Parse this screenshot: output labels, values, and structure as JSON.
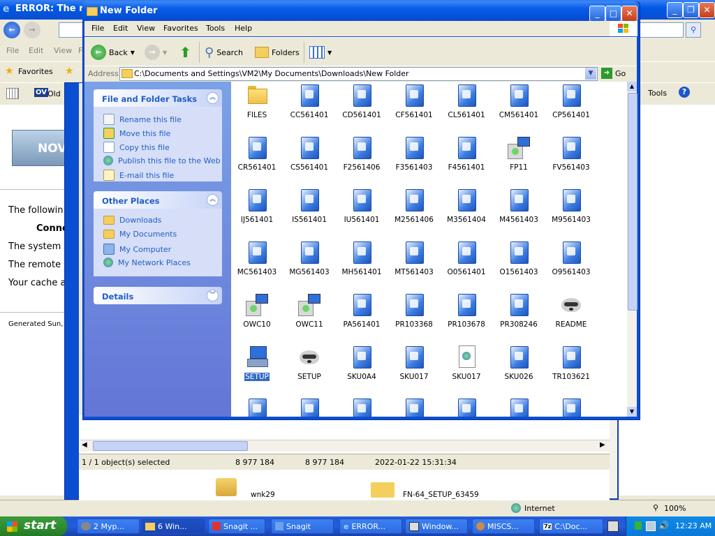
{
  "ie": {
    "title": "ERROR: The req",
    "menu": [
      "File",
      "Edit",
      "View",
      "F"
    ],
    "favorites_label": "Favorites",
    "ov_label": "Old",
    "tools_label": "Tools",
    "content_lines": [
      "The followin",
      "Conne",
      "The system",
      "The remote",
      "Your cache a"
    ],
    "generated": "Generated Sun,",
    "logo_text": "NOV",
    "status_zone": "Internet",
    "zoom": "100%"
  },
  "mid": {
    "status_items": [
      "1 / 1 object(s) selected",
      "8 977 184",
      "8 977 184",
      "2022-01-22 15:31:34"
    ],
    "bottom_items": [
      "wnk29",
      "FN-64_SETUP_63459"
    ]
  },
  "window": {
    "title": "New Folder",
    "menu": [
      "File",
      "Edit",
      "View",
      "Favorites",
      "Tools",
      "Help"
    ],
    "toolbar": {
      "back": "Back",
      "search": "Search",
      "folders": "Folders"
    },
    "address_label": "Address",
    "address": "C:\\Documents and Settings\\VM2\\My Documents\\Downloads\\New Folder",
    "go": "Go"
  },
  "tasks": {
    "title": "File and Folder Tasks",
    "items": [
      "Rename this file",
      "Move this file",
      "Copy this file",
      "Publish this file to the Web",
      "E-mail this file"
    ]
  },
  "places": {
    "title": "Other Places",
    "items": [
      "Downloads",
      "My Documents",
      "My Computer",
      "My Network Places"
    ]
  },
  "details": {
    "title": "Details"
  },
  "files": [
    {
      "name": "FILES",
      "icon": "folder"
    },
    {
      "name": "CC561401",
      "icon": "package"
    },
    {
      "name": "CD561401",
      "icon": "package"
    },
    {
      "name": "CF561401",
      "icon": "package"
    },
    {
      "name": "CL561401",
      "icon": "package"
    },
    {
      "name": "CM561401",
      "icon": "package"
    },
    {
      "name": "CP561401",
      "icon": "package"
    },
    {
      "name": "CR561401",
      "icon": "package"
    },
    {
      "name": "CS561401",
      "icon": "package"
    },
    {
      "name": "F2561406",
      "icon": "package"
    },
    {
      "name": "F3561403",
      "icon": "package"
    },
    {
      "name": "F4561401",
      "icon": "package"
    },
    {
      "name": "FP11",
      "icon": "installer"
    },
    {
      "name": "FV561403",
      "icon": "package"
    },
    {
      "name": "IJ561401",
      "icon": "package"
    },
    {
      "name": "IS561401",
      "icon": "package"
    },
    {
      "name": "IU561401",
      "icon": "package"
    },
    {
      "name": "M2561406",
      "icon": "package"
    },
    {
      "name": "M3561404",
      "icon": "package"
    },
    {
      "name": "M4561403",
      "icon": "package"
    },
    {
      "name": "M9561403",
      "icon": "package"
    },
    {
      "name": "MC561403",
      "icon": "package"
    },
    {
      "name": "MG561403",
      "icon": "package"
    },
    {
      "name": "MH561401",
      "icon": "package"
    },
    {
      "name": "MT561403",
      "icon": "package"
    },
    {
      "name": "O0561401",
      "icon": "package"
    },
    {
      "name": "O1561403",
      "icon": "package"
    },
    {
      "name": "O9561403",
      "icon": "package"
    },
    {
      "name": "OWC10",
      "icon": "installer"
    },
    {
      "name": "OWC11",
      "icon": "installer"
    },
    {
      "name": "PA561401",
      "icon": "package"
    },
    {
      "name": "PR103368",
      "icon": "package"
    },
    {
      "name": "PR103678",
      "icon": "package"
    },
    {
      "name": "PR308246",
      "icon": "package"
    },
    {
      "name": "README",
      "icon": "raccoon"
    },
    {
      "name": "SETUP",
      "icon": "setup",
      "selected": true
    },
    {
      "name": "SETUP",
      "icon": "raccoon"
    },
    {
      "name": "SKU0A4",
      "icon": "package"
    },
    {
      "name": "SKU017",
      "icon": "package"
    },
    {
      "name": "SKU017",
      "icon": "web-document"
    },
    {
      "name": "SKU026",
      "icon": "package"
    },
    {
      "name": "TR103621",
      "icon": "package"
    },
    {
      "name": "",
      "icon": "package"
    },
    {
      "name": "",
      "icon": "package"
    },
    {
      "name": "",
      "icon": "package"
    },
    {
      "name": "",
      "icon": "package"
    },
    {
      "name": "",
      "icon": "package"
    },
    {
      "name": "",
      "icon": "package"
    },
    {
      "name": "",
      "icon": "package"
    }
  ],
  "taskbar": {
    "start": "start",
    "buttons": [
      "2 Myp...",
      "6 Win...",
      "Snagit ...",
      "Snagit",
      "ERROR...",
      "Window...",
      "MISCS...",
      "C:\\Doc..."
    ],
    "clock": "12:23 AM"
  }
}
